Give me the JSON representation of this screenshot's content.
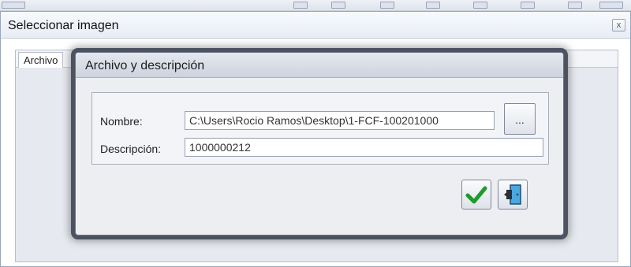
{
  "outer_dialog": {
    "title": "Seleccionar imagen",
    "close_glyph": "x",
    "tab_label": "Archivo"
  },
  "dialog": {
    "title": "Archivo y descripción",
    "name_label": "Nombre:",
    "name_value": "C:\\Users\\Rocio Ramos\\Desktop\\1-FCF-100201000",
    "browse_label": "...",
    "description_label": "Descripción:",
    "description_value": "1000000212",
    "ok_icon": "checkmark-icon",
    "exit_icon": "exit-door-icon"
  },
  "colors": {
    "accept_green": "#1f9a2c",
    "exit_blue": "#4aa8e0"
  }
}
